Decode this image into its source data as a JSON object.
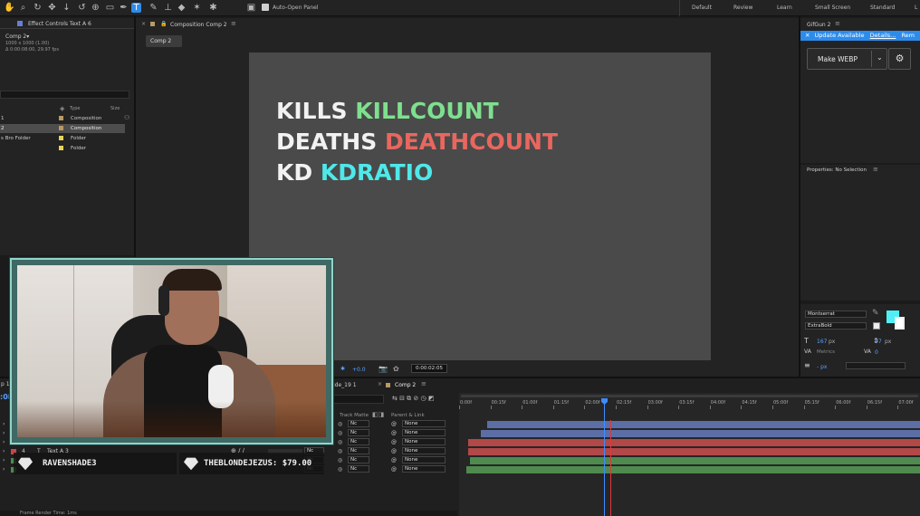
{
  "toolbar": {
    "auto_open_label": "Auto-Open Panel",
    "workspaces": [
      "Default",
      "Review",
      "Learn",
      "Small Screen",
      "Standard",
      "L"
    ]
  },
  "effect_controls": {
    "tab": "Effect Controls Text A 6",
    "comp_name": "Comp 2▾",
    "comp_size": "1000 x 1000 (1.00)",
    "comp_duration": "Δ 0:00:08:00, 29.97 fps"
  },
  "project": {
    "headers": [
      "Type",
      "Size"
    ],
    "rows": [
      {
        "name": "1",
        "type": "Composition",
        "color": "#b89a64"
      },
      {
        "name": "2",
        "type": "Composition",
        "color": "#b89a64"
      },
      {
        "name": "s Bro Folder",
        "type": "Folder",
        "color": "#e6d45a"
      },
      {
        "name": "",
        "type": "Folder",
        "color": "#e6d45a"
      }
    ]
  },
  "composition": {
    "tab": "Composition Comp 2",
    "subtab": "Comp 2",
    "lines": [
      {
        "label": "KILLS",
        "value": "KILLCOUNT",
        "color": "#7ee08f"
      },
      {
        "label": "DEATHS",
        "value": "DEATHCOUNT",
        "color": "#e8675f"
      },
      {
        "label": "KD",
        "value": "KDRATIO",
        "color": "#4fe8ea"
      }
    ],
    "exposure": "+0.0",
    "timecode": "0:00:02:05"
  },
  "gifgun": {
    "title": "GifGun 2",
    "update_text": "Update Available",
    "details_link": "Details...",
    "remind_link": "Rem",
    "make_button": "Make WEBP"
  },
  "properties": {
    "title": "Properties: No Selection"
  },
  "character": {
    "font": "Montserrat",
    "weight": "ExtraBold",
    "size": "167",
    "size_unit": "px",
    "leading": "97",
    "leading_unit": "px",
    "kerning": "Metrics",
    "tracking": "0",
    "stroke": "- px",
    "fill_color": "#4ff0f5"
  },
  "timeline": {
    "tabs": [
      "ide_19 1",
      "Comp 2"
    ],
    "current_time": ":08",
    "col_track_matte": "Track Matte",
    "col_parent": "Parent & Link",
    "ruler": [
      "0:00f",
      "00:15f",
      "01:00f",
      "01:15f",
      "02:00f",
      "02:15f",
      "03:00f",
      "03:15f",
      "04:00f",
      "04:15f",
      "05:00f",
      "05:15f",
      "06:00f",
      "06:15f",
      "07:00f"
    ],
    "visible_layer": {
      "num": "4",
      "name": "Text A 3",
      "color": "#c94646"
    },
    "layers": [
      {
        "matte": "Nc",
        "parent": "None",
        "bar_color": "#5b6fa6"
      },
      {
        "matte": "Nc",
        "parent": "None",
        "bar_color": "#5b6fa6"
      },
      {
        "matte": "Nc",
        "parent": "None",
        "bar_color": "#b24848"
      },
      {
        "matte": "Nc",
        "parent": "None",
        "bar_color": "#b24848"
      },
      {
        "matte": "Nc",
        "parent": "None",
        "bar_color": "#4f8a4f"
      },
      {
        "matte": "Nc",
        "parent": "None",
        "bar_color": "#4f8a4f"
      }
    ],
    "footer": "Frame Render Time: 1ms"
  },
  "overlay": {
    "donor1": "RAVENSHADE3",
    "donor2": "THEBLONDEJEZUS: $79.00",
    "frame_color": "#6fbcb4"
  }
}
